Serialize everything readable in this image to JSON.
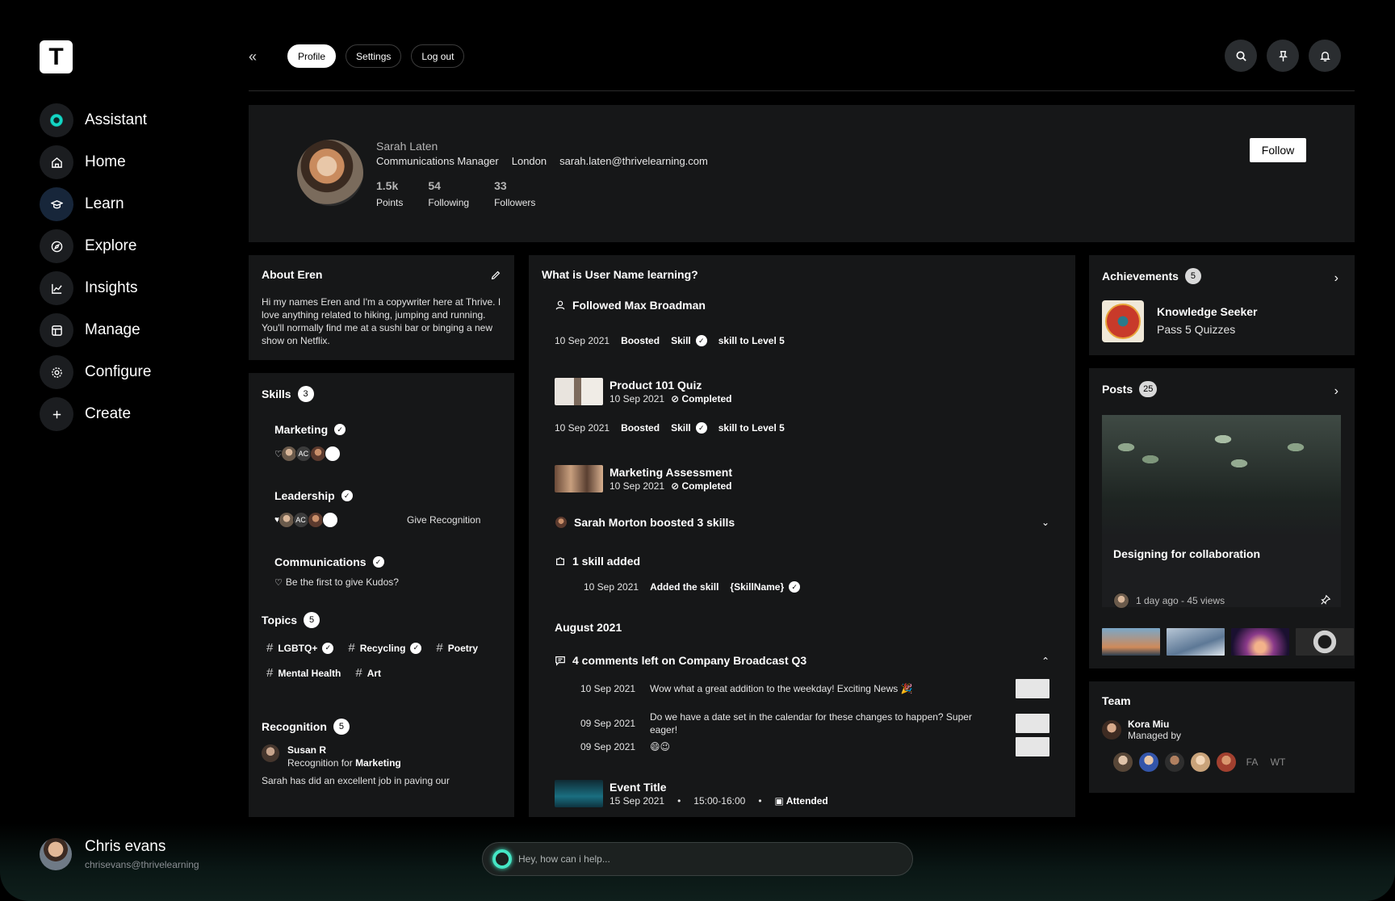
{
  "logo": {
    "letter": "T"
  },
  "sidebar": {
    "items": [
      {
        "label": "Assistant"
      },
      {
        "label": "Home"
      },
      {
        "label": "Learn"
      },
      {
        "label": "Explore"
      },
      {
        "label": "Insights"
      },
      {
        "label": "Manage"
      },
      {
        "label": "Configure"
      },
      {
        "label": "Create"
      }
    ],
    "user": {
      "name": "Chris evans",
      "email": "chrisevans@thrivelearning"
    }
  },
  "header": {
    "collapse_icon": "«",
    "tabs": [
      {
        "label": "Profile",
        "active": true
      },
      {
        "label": "Settings"
      },
      {
        "label": "Log out"
      }
    ]
  },
  "assistant": {
    "placeholder": "Hey, how can i help..."
  },
  "profile": {
    "name": "Sarah Laten",
    "role": "Communications Manager",
    "location": "London",
    "email": "sarah.laten@thrivelearning.com",
    "stats": [
      {
        "value": "1.5k",
        "label": "Points"
      },
      {
        "value": "54",
        "label": "Following"
      },
      {
        "value": "33",
        "label": "Followers"
      }
    ],
    "follow_label": "Follow"
  },
  "about": {
    "title": "About Eren",
    "text": "Hi my names Eren and I'm a copywriter here at Thrive. I love anything related to hiking, jumping and running. You'll normally find me at a sushi bar or binging a new show on Netflix."
  },
  "skills": {
    "title": "Skills",
    "count": "3",
    "avatar_initials": "AC",
    "items": [
      {
        "name": "Marketing"
      },
      {
        "name": "Leadership",
        "action": "Give Recognition"
      },
      {
        "name": "Communications",
        "kudos_text": "Be the first to give Kudos?"
      }
    ]
  },
  "topics": {
    "title": "Topics",
    "count": "5",
    "items": [
      "LGBTQ+",
      "Recycling",
      "Poetry",
      "Mental Health",
      "Art"
    ]
  },
  "recognition": {
    "title": "Recognition",
    "count": "5",
    "name": "Susan R",
    "for_prefix": "Recognition for",
    "for_skill": "Marketing",
    "text": "Sarah has did an excellent job in paving our"
  },
  "feed": {
    "title": "What is User Name learning?",
    "followed": "Followed Max Broadman",
    "boost_1": {
      "date": "10 Sep 2021",
      "boosted": "Boosted",
      "skill": "Skill",
      "level": "skill to Level 5"
    },
    "quiz": {
      "title": "Product 101 Quiz",
      "date": "10 Sep 2021",
      "status": "Completed"
    },
    "boost_2": {
      "date": "10 Sep 2021",
      "boosted": "Boosted",
      "skill": "Skill",
      "level": "skill to Level 5"
    },
    "assessment": {
      "title": "Marketing Assessment",
      "date": "10 Sep 2021",
      "status": "Completed"
    },
    "boosted_group": "Sarah Morton boosted 3 skills",
    "skill_added": "1 skill added",
    "skill_added_row": {
      "date": "10 Sep 2021",
      "action": "Added the skill",
      "skill": "{SkillName}"
    },
    "month": "August 2021",
    "comments_title": "4 comments left on Company Broadcast Q3",
    "comments": [
      {
        "date": "10 Sep 2021",
        "text": "Wow what a great addition to the weekday! Exciting News 🎉"
      },
      {
        "date": "09 Sep 2021",
        "text": "Do we have a date set in the calendar for these changes to happen? Super eager!"
      },
      {
        "date": "09 Sep 2021",
        "text": "😄😉"
      }
    ],
    "event": {
      "title": "Event Title",
      "date": "15 Sep 2021",
      "time": "15:00-16:00",
      "status": "Attended",
      "sep": "•"
    }
  },
  "achievements": {
    "title": "Achievements",
    "count": "5",
    "name": "Knowledge Seeker",
    "desc": "Pass 5 Quizzes"
  },
  "posts": {
    "title": "Posts",
    "count": "25",
    "post_title": "Designing for collaboration",
    "meta": "1 day ago - 45 views"
  },
  "team": {
    "title": "Team",
    "lead_name": "Kora Miu",
    "lead_sub": "Managed by",
    "initials": [
      "FA",
      "WT"
    ]
  }
}
